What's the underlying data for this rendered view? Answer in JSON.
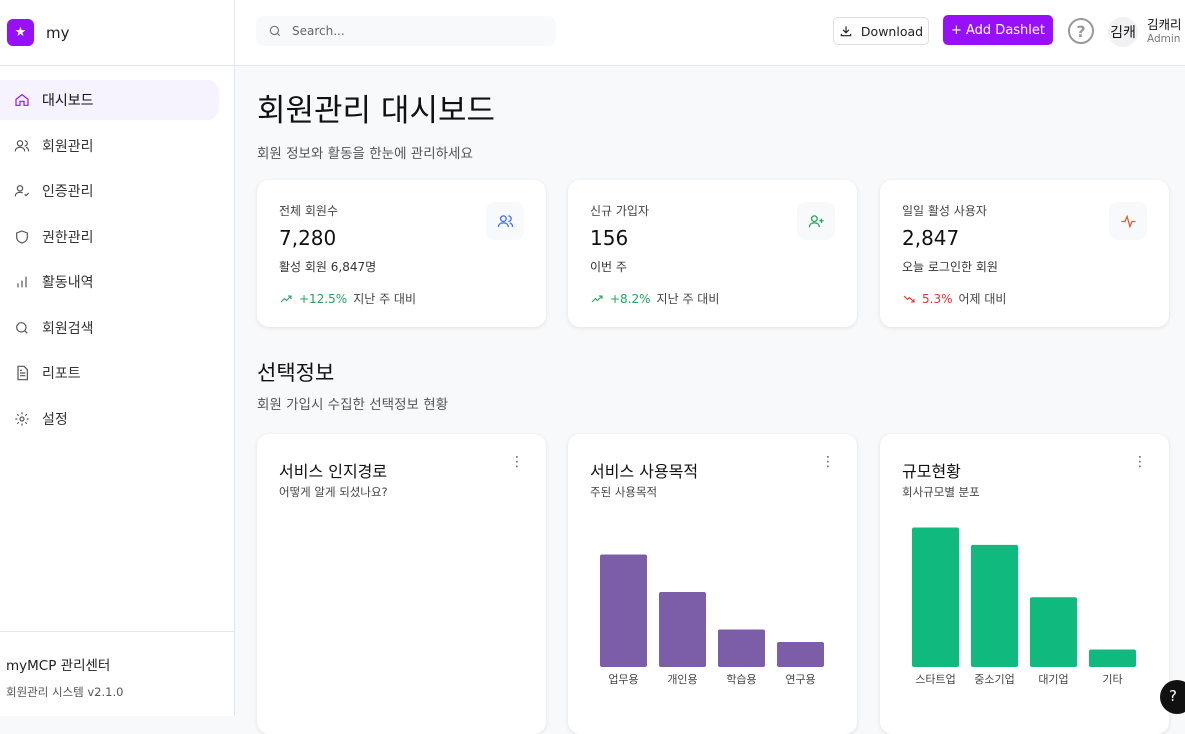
{
  "sidebar": {
    "logo": "my",
    "items": [
      {
        "label": "대시보드"
      },
      {
        "label": "회원관리"
      },
      {
        "label": "인증관리"
      },
      {
        "label": "권한관리"
      },
      {
        "label": "활동내역"
      },
      {
        "label": "회원검색"
      },
      {
        "label": "리포트"
      },
      {
        "label": "설정"
      }
    ],
    "footer_title": "myMCP 관리센터",
    "footer_sub": "회원관리 시스템 v2.1.0"
  },
  "topbar": {
    "search_placeholder": "Search...",
    "download": "Download",
    "add": "+ Add Dashlet",
    "help": "?",
    "avatar": "김캐",
    "user_name": "김캐리",
    "user_role": "Admin"
  },
  "page": {
    "title": "회원관리 대시보드",
    "subtitle": "회원 정보와 활동을 한눈에 관리하세요"
  },
  "stats": [
    {
      "label": "전체 회원수",
      "value": "7,280",
      "desc": "활성 회원 6,847명",
      "change": "+12.5%",
      "compare": "지난 주 대비",
      "color": "#22a35a",
      "icon_color": "#3b6cf6"
    },
    {
      "label": "신규 가입자",
      "value": "156",
      "desc": "이번 주",
      "change": "+8.2%",
      "compare": "지난 주 대비",
      "color": "#22a35a",
      "icon_color": "#22a35a"
    },
    {
      "label": "일일 활성 사용자",
      "value": "2,847",
      "desc": "오늘 로그인한 회원",
      "change": "5.3%",
      "compare": "어제 대비",
      "color": "#e5312f",
      "icon_color": "#f0522b"
    }
  ],
  "section": {
    "title": "선택정보",
    "subtitle": "회원 가입시 수집한 선택정보 현황"
  },
  "cards": [
    {
      "title": "서비스 인지경로",
      "subtitle": "어떻게 알게 되셨나요?"
    },
    {
      "title": "서비스 사용목적",
      "subtitle": "주된 사용목적"
    },
    {
      "title": "규모현황",
      "subtitle": "회사규모별 분포"
    }
  ],
  "chart_data": [
    {
      "type": "bar",
      "title": "서비스 사용목적",
      "categories": [
        "업무용",
        "개인용",
        "학습용",
        "연구용"
      ],
      "values": [
        45,
        30,
        15,
        10
      ],
      "ylim": [
        0,
        60
      ],
      "color": "#7b5ea7"
    },
    {
      "type": "bar",
      "title": "규모현황",
      "categories": [
        "스타트업",
        "중소기업",
        "대기업",
        "기타"
      ],
      "values": [
        40,
        35,
        20,
        5
      ],
      "ylim": [
        0,
        43
      ],
      "color": "#10b97d"
    }
  ]
}
